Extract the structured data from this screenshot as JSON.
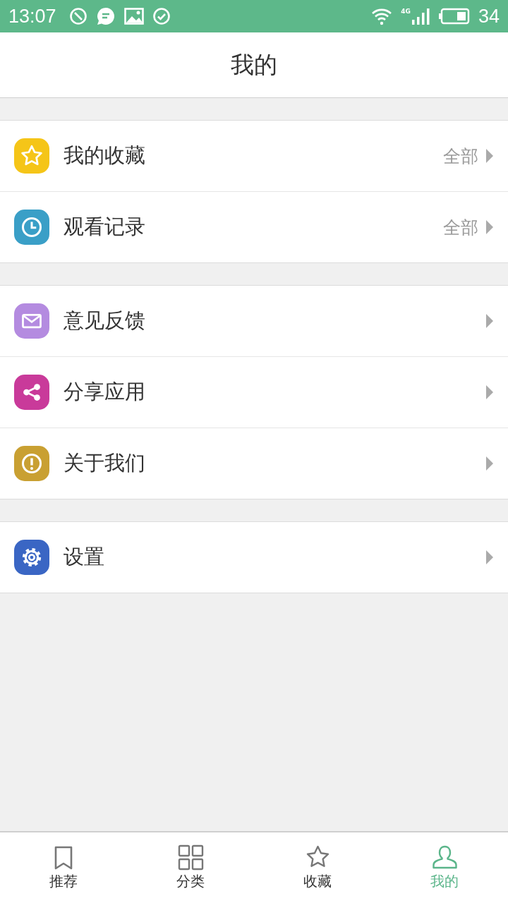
{
  "status_bar": {
    "time": "13:07",
    "network": "4G",
    "battery": "34"
  },
  "header": {
    "title": "我的"
  },
  "groups": [
    {
      "items": [
        {
          "label": "我的收藏",
          "kind": "star",
          "color": "#f5c518",
          "detail": "全部"
        },
        {
          "label": "观看记录",
          "kind": "clock",
          "color": "#3a9fc7",
          "detail": "全部"
        }
      ]
    },
    {
      "items": [
        {
          "label": "意见反馈",
          "kind": "mail",
          "color": "#b48be0"
        },
        {
          "label": "分享应用",
          "kind": "share",
          "color": "#c93a9a"
        },
        {
          "label": "关于我们",
          "kind": "info",
          "color": "#c9a032"
        }
      ]
    },
    {
      "items": [
        {
          "label": "设置",
          "kind": "gear",
          "color": "#3a66c4"
        }
      ]
    }
  ],
  "tabs": [
    {
      "label": "推荐",
      "kind": "bookmark",
      "selected": false
    },
    {
      "label": "分类",
      "kind": "grid",
      "selected": false
    },
    {
      "label": "收藏",
      "kind": "star",
      "selected": false
    },
    {
      "label": "我的",
      "kind": "person",
      "selected": true
    }
  ]
}
